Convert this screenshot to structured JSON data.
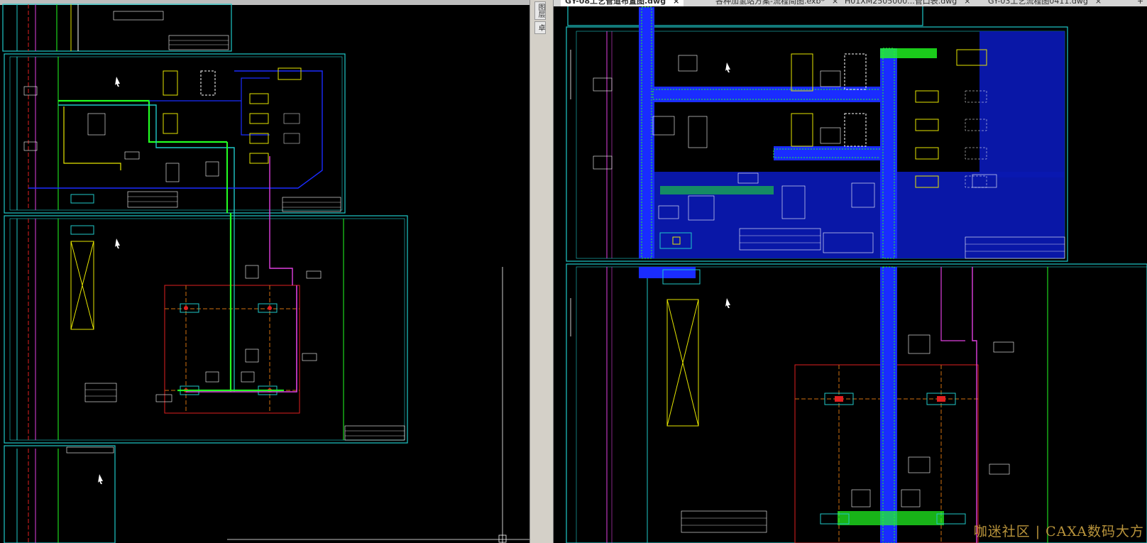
{
  "tabs": [
    {
      "label": "GY-08工艺管道布置图.dwg",
      "active": true
    },
    {
      "label": "各种加氢站方案-流程简图.exb*",
      "active": false
    },
    {
      "label": "H01XM2505000...管口表.dwg",
      "active": false
    },
    {
      "label": "GY-03工艺流程图0411.dwg",
      "active": false
    }
  ],
  "new_tab_label": "+",
  "close_glyph": "×",
  "side_panel_labels": [
    "图层",
    "卓"
  ],
  "watermark": "咖迷社区 | CAXA数码大方",
  "colors": {
    "background": "#000000",
    "frame": "#1fc8c8",
    "pipe_green": "#22ff22",
    "pipe_blue": "#1a2cff",
    "pipe_magenta": "#e040e0",
    "yellow": "#e6e600",
    "red": "#e02020",
    "orange": "#d07010",
    "white": "#ffffff"
  },
  "icons": [
    "close-icon",
    "plus-icon",
    "cursor-icon"
  ]
}
